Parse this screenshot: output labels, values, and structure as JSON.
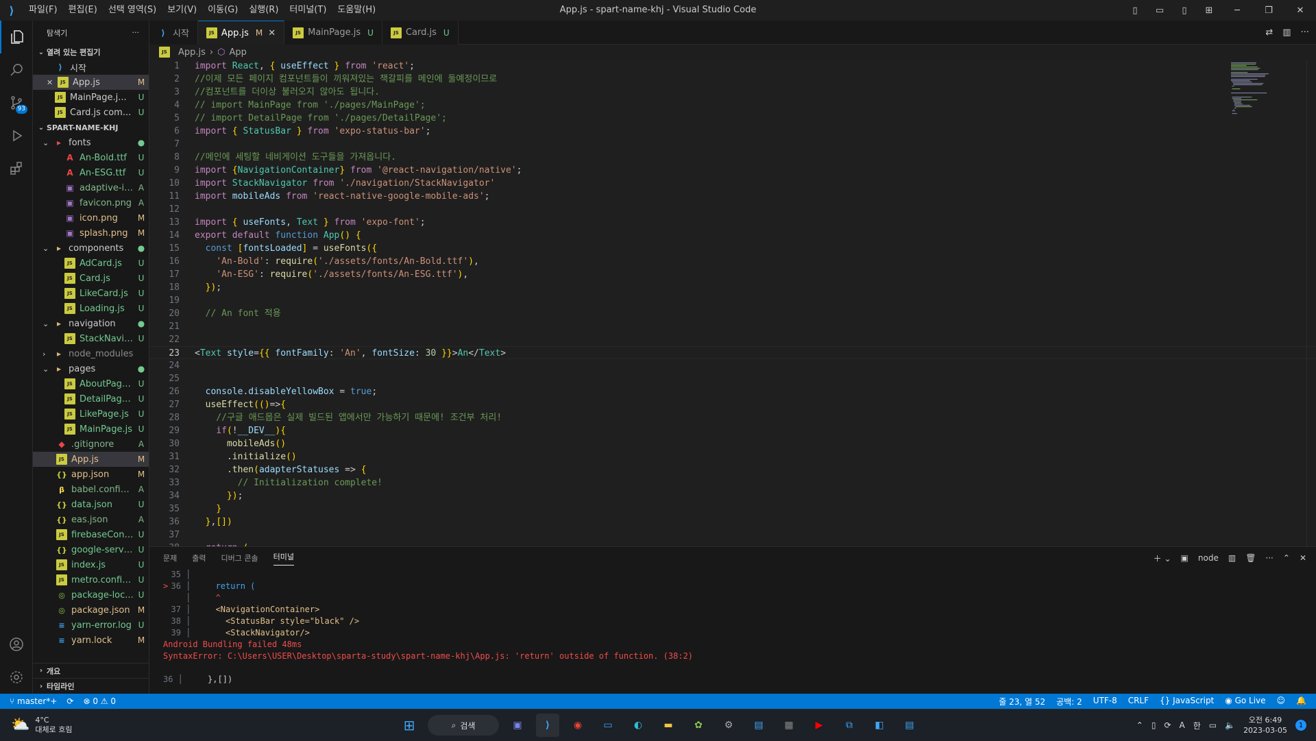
{
  "title_bar": {
    "window_title": "App.js - spart-name-khj - Visual Studio Code",
    "menus": [
      "파일(F)",
      "편집(E)",
      "선택 영역(S)",
      "보기(V)",
      "이동(G)",
      "실행(R)",
      "터미널(T)",
      "도움말(H)"
    ]
  },
  "activity_bar": {
    "scm_badge": "93"
  },
  "sidebar": {
    "title": "탐색기",
    "open_editors_title": "열려 있는 편집기",
    "open_editors": [
      {
        "name": "시작",
        "status": "",
        "icon": "vscode-icon"
      },
      {
        "name": "App.js",
        "status": "M",
        "icon": "js-icon"
      },
      {
        "name": "MainPage.j...",
        "status": "U",
        "icon": "js-icon"
      },
      {
        "name": "Card.js com...",
        "status": "U",
        "icon": "js-icon"
      }
    ],
    "project_title": "SPART-NAME-KHJ",
    "files": [
      {
        "name": "fonts",
        "status": "●",
        "type": "folder"
      },
      {
        "name": "An-Bold.ttf",
        "status": "U",
        "type": "font"
      },
      {
        "name": "An-ESG.ttf",
        "status": "U",
        "type": "font"
      },
      {
        "name": "adaptive-ic...",
        "status": "A",
        "type": "img"
      },
      {
        "name": "favicon.png",
        "status": "A",
        "type": "img"
      },
      {
        "name": "icon.png",
        "status": "M",
        "type": "img"
      },
      {
        "name": "splash.png",
        "status": "M",
        "type": "img"
      },
      {
        "name": "components",
        "status": "●",
        "type": "folder"
      },
      {
        "name": "AdCard.js",
        "status": "U",
        "type": "js"
      },
      {
        "name": "Card.js",
        "status": "U",
        "type": "js"
      },
      {
        "name": "LikeCard.js",
        "status": "U",
        "type": "js"
      },
      {
        "name": "Loading.js",
        "status": "U",
        "type": "js"
      },
      {
        "name": "navigation",
        "status": "●",
        "type": "folder"
      },
      {
        "name": "StackNavig...",
        "status": "U",
        "type": "js"
      },
      {
        "name": "node_modules",
        "status": "",
        "type": "folder"
      },
      {
        "name": "pages",
        "status": "●",
        "type": "folder"
      },
      {
        "name": "AboutPage.js",
        "status": "U",
        "type": "js"
      },
      {
        "name": "DetailPage.js",
        "status": "U",
        "type": "js"
      },
      {
        "name": "LikePage.js",
        "status": "U",
        "type": "js"
      },
      {
        "name": "MainPage.js",
        "status": "U",
        "type": "js"
      },
      {
        "name": ".gitignore",
        "status": "A",
        "type": "git"
      },
      {
        "name": "App.js",
        "status": "M",
        "type": "js"
      },
      {
        "name": "app.json",
        "status": "M",
        "type": "json"
      },
      {
        "name": "babel.config.js",
        "status": "A",
        "type": "babel"
      },
      {
        "name": "data.json",
        "status": "U",
        "type": "json"
      },
      {
        "name": "eas.json",
        "status": "A",
        "type": "json"
      },
      {
        "name": "firebaseConf...",
        "status": "U",
        "type": "js"
      },
      {
        "name": "google-servi...",
        "status": "U",
        "type": "json"
      },
      {
        "name": "index.js",
        "status": "U",
        "type": "js"
      },
      {
        "name": "metro.config.js",
        "status": "U",
        "type": "js"
      },
      {
        "name": "package-loc...",
        "status": "U",
        "type": "pkg"
      },
      {
        "name": "package.json",
        "status": "M",
        "type": "pkg"
      },
      {
        "name": "yarn-error.log",
        "status": "U",
        "type": "log"
      },
      {
        "name": "yarn.lock",
        "status": "M",
        "type": "log"
      }
    ],
    "outline_title": "개요",
    "timeline_title": "타임라인"
  },
  "tabs": [
    {
      "label": "시작",
      "status": ""
    },
    {
      "label": "App.js",
      "status": "M"
    },
    {
      "label": "MainPage.js",
      "status": "U"
    },
    {
      "label": "Card.js",
      "status": "U"
    }
  ],
  "breadcrumb": {
    "file": "App.js",
    "symbol": "App"
  },
  "editor": {
    "current_line": 23,
    "lines": [
      "import React, { useEffect } from 'react';",
      "//이제 모든 페이지 컴포넌트들이 끼워져있는 책갈피를 메인에 둘예정이므로",
      "//컴포넌트를 더이상 불러오지 않아도 됩니다.",
      "// import MainPage from './pages/MainPage';",
      "// import DetailPage from './pages/DetailPage';",
      "import { StatusBar } from 'expo-status-bar';",
      "",
      "//메인에 세팅할 네비게이션 도구들을 가져옵니다.",
      "import {NavigationContainer} from '@react-navigation/native';",
      "import StackNavigator from './navigation/StackNavigator'",
      "import mobileAds from 'react-native-google-mobile-ads';",
      "",
      "import { useFonts, Text } from 'expo-font';",
      "export default function App() {",
      "  const [fontsLoaded] = useFonts({",
      "    'An-Bold': require('./assets/fonts/An-Bold.ttf'),",
      "    'An-ESG': require('./assets/fonts/An-ESG.ttf'),",
      "  });",
      "",
      "  // An font 적용",
      "",
      "",
      "<Text style={{ fontFamily: 'An', fontSize: 30 }}>An</Text>",
      "",
      "",
      "  console.disableYellowBox = true;",
      "  useEffect(()=>{",
      "    //구글 애드몹은 실제 빌드된 앱에서만 가능하기 때문에! 조건부 처리!",
      "    if(!__DEV__){",
      "      mobileAds()",
      "      .initialize()",
      "      .then(adapterStatuses => {",
      "        // Initialization complete!",
      "      });",
      "    }",
      "  },[])",
      "",
      "  return ("
    ]
  },
  "panel": {
    "tabs": [
      "문제",
      "출력",
      "디버그 콘솔",
      "터미널"
    ],
    "active_tab": "터미널",
    "terminal_name": "node",
    "output": [
      {
        "gutter": "35",
        "marker": "",
        "text": ""
      },
      {
        "gutter": "36",
        "marker": ">",
        "text": "    return ("
      },
      {
        "gutter": "",
        "marker": "",
        "text": "    ^"
      },
      {
        "gutter": "37",
        "marker": "",
        "text": "    <NavigationContainer>"
      },
      {
        "gutter": "38",
        "marker": "",
        "text": "      <StatusBar style=\"black\" />"
      },
      {
        "gutter": "39",
        "marker": "",
        "text": "      <StackNavigator/>"
      }
    ],
    "error_title": "Android Bundling failed 48ms",
    "error_msg": "SyntaxError: C:\\Users\\USER\\Desktop\\sparta-study\\spart-name-khj\\App.js: 'return' outside of function. (38:2)",
    "tail": {
      "gutter": "36",
      "text": "    },[])"
    }
  },
  "status_bar": {
    "branch": "master*+",
    "problems": "⊗ 0 ⚠ 0",
    "position": "줄 23, 열 52",
    "indent": "공백: 2",
    "encoding": "UTF-8",
    "eol": "CRLF",
    "language": "JavaScript",
    "golive": "Go Live"
  },
  "taskbar": {
    "temp": "4°C",
    "weather": "대체로 흐림",
    "search": "검색",
    "ime": "한",
    "time": "오전 6:49",
    "date": "2023-03-05",
    "notif": "1",
    "lang": "A"
  }
}
